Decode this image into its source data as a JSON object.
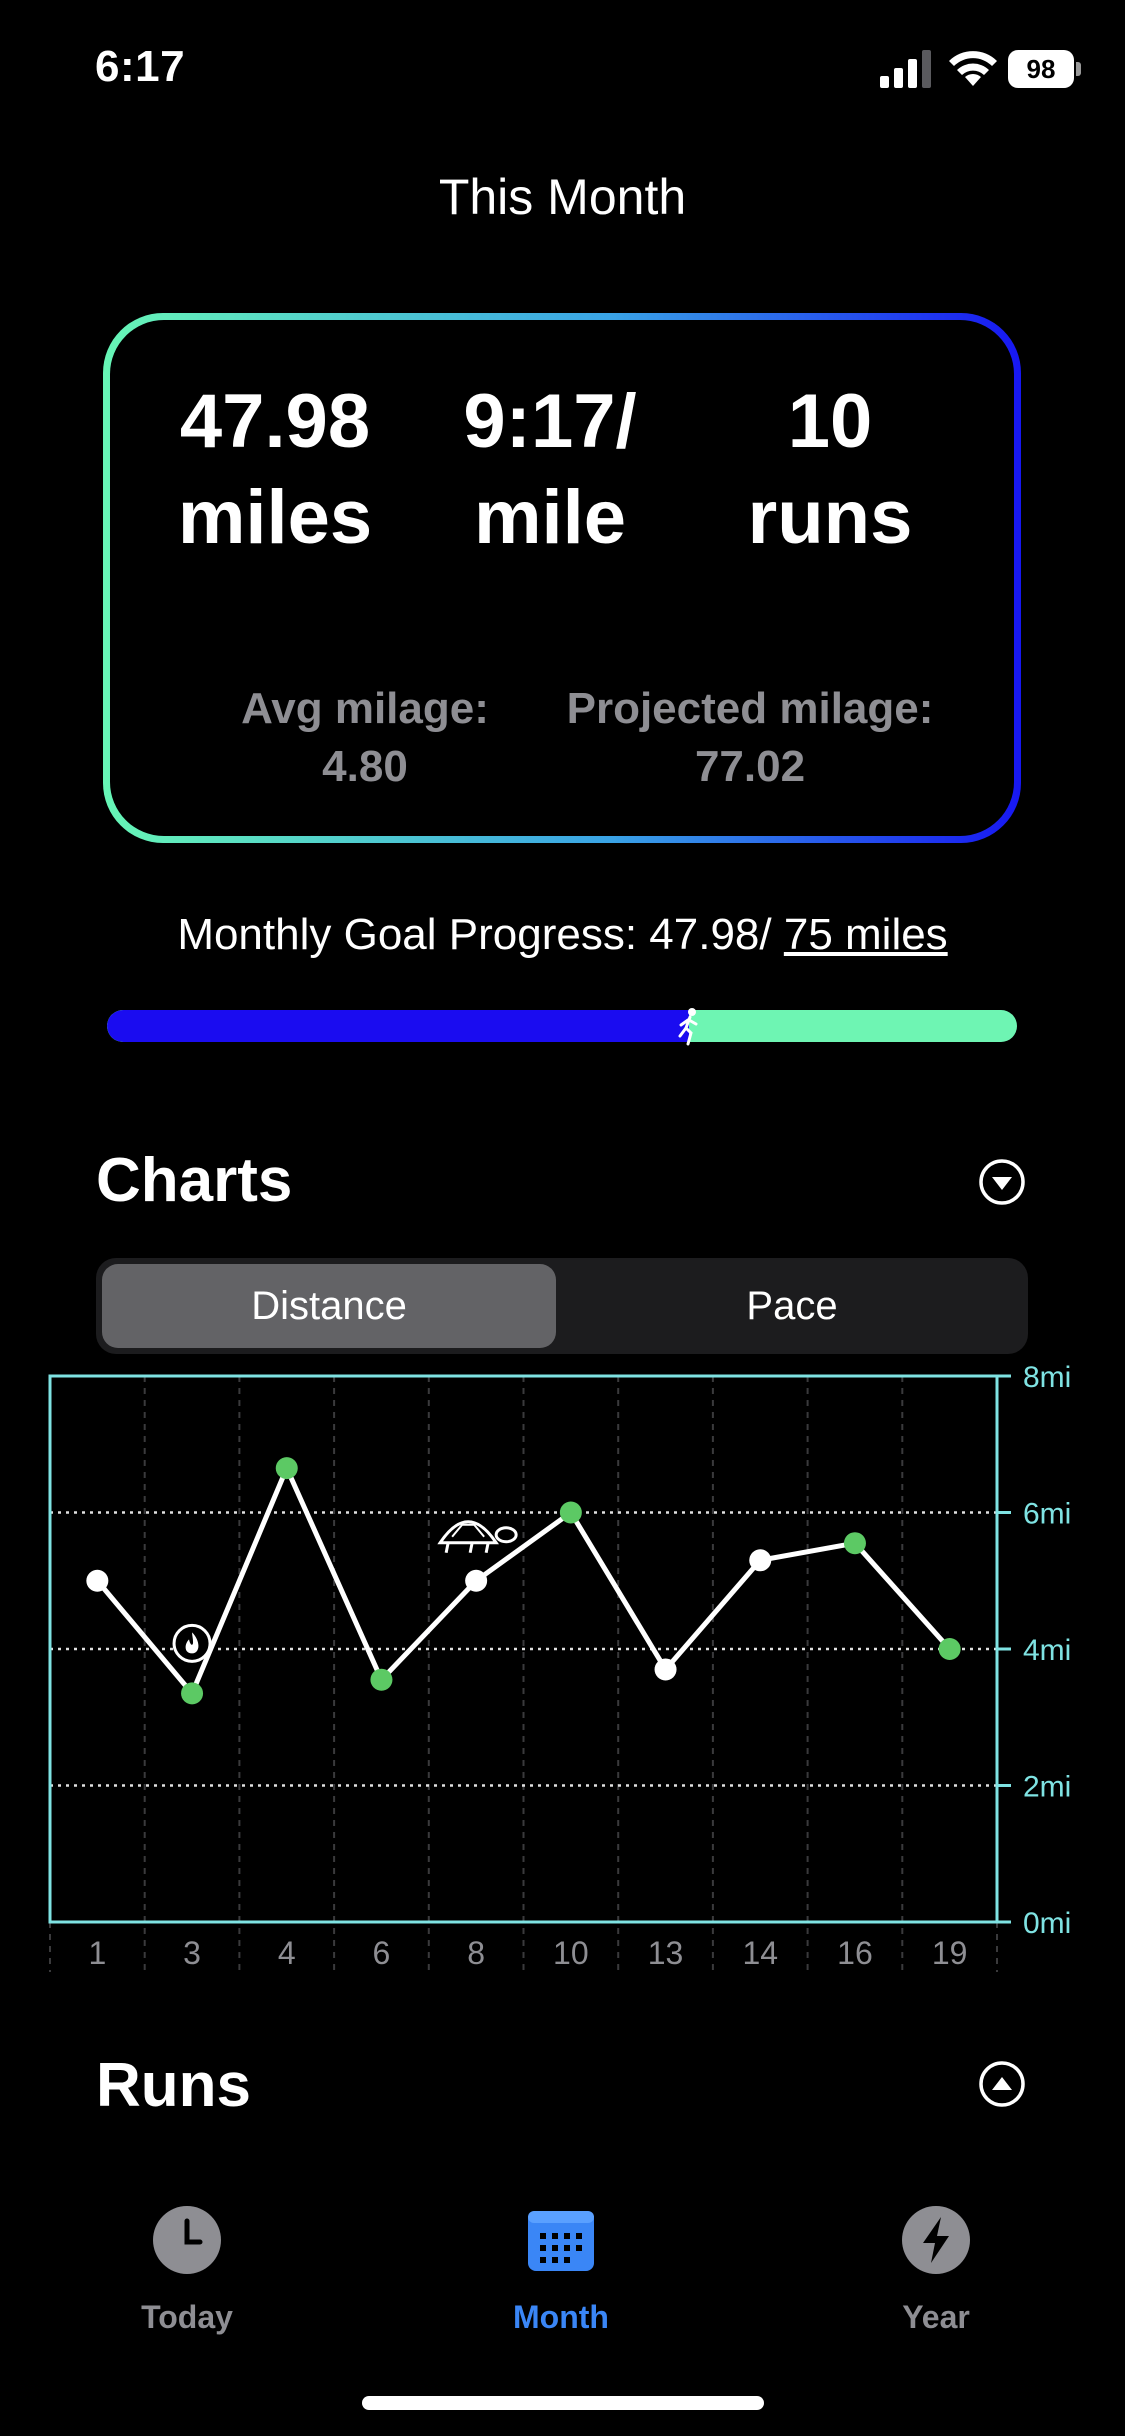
{
  "status_bar": {
    "time": "6:17",
    "battery": "98",
    "icons": [
      "signal-icon",
      "wifi-icon",
      "battery-icon"
    ]
  },
  "header": {
    "title": "This Month"
  },
  "stats": {
    "distance_value": "47.98",
    "distance_unit": "miles",
    "pace_value": "9:17/",
    "pace_unit": "mile",
    "runs_value": "10",
    "runs_unit": "runs",
    "avg_label": "Avg milage:",
    "avg_value": "4.80",
    "projected_label": "Projected milage:",
    "projected_value": "77.02"
  },
  "goal": {
    "label": "Monthly Goal Progress: 47.98/ ",
    "target_link": "75 miles",
    "progress_fraction": 0.6397
  },
  "charts_section": {
    "title": "Charts",
    "toggle_icon": "chevron-down-circle-icon"
  },
  "segmented": {
    "options": [
      "Distance",
      "Pace"
    ],
    "selected": "Distance"
  },
  "chart_data": {
    "type": "line",
    "categories": [
      "1",
      "3",
      "4",
      "6",
      "8",
      "10",
      "13",
      "14",
      "16",
      "19"
    ],
    "values": [
      5.0,
      3.35,
      6.65,
      3.55,
      5.0,
      6.0,
      3.7,
      5.3,
      5.55,
      4.0
    ],
    "point_colors": [
      "#ffffff",
      "#5cc964",
      "#5cc964",
      "#5cc964",
      "#ffffff",
      "#5cc964",
      "#ffffff",
      "#ffffff",
      "#5cc964",
      "#5cc964"
    ],
    "y_ticks": [
      "0mi",
      "2mi",
      "4mi",
      "6mi",
      "8mi"
    ],
    "ylim": [
      0,
      8
    ],
    "grid": true,
    "annotations": [
      {
        "category": "3",
        "icon": "flame-circle-icon"
      },
      {
        "category": "8",
        "icon": "turtle-icon"
      }
    ],
    "line_color": "#ffffff",
    "frame_color": "#7fe3e3"
  },
  "runs_section": {
    "title": "Runs",
    "toggle_icon": "chevron-up-circle-icon"
  },
  "tab_bar": {
    "tabs": [
      {
        "label": "Today",
        "icon": "clock-icon"
      },
      {
        "label": "Month",
        "icon": "calendar-icon",
        "active": true
      },
      {
        "label": "Year",
        "icon": "bolt-icon"
      }
    ],
    "active_color": "#3a86f6"
  }
}
